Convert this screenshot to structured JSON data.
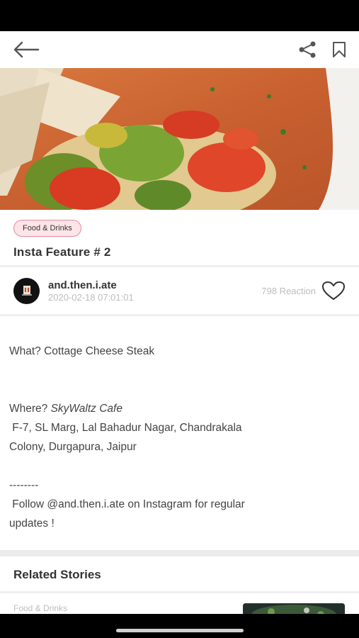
{
  "header": {
    "back_icon": "arrow-left-icon",
    "share_icon": "share-icon",
    "bookmark_icon": "bookmark-icon"
  },
  "post": {
    "category": "Food & Drinks",
    "title": "Insta Feature # 2",
    "author": {
      "name": "and.then.i.ate",
      "date": "2020-02-18 07:01:01"
    },
    "reactions": "798 Reaction",
    "body": {
      "what": "What? Cottage Cheese Steak",
      "where_prefix": "Where?",
      "where_place": "SkyWaltz Cafe",
      "address_1": " F-7, SL Marg, Lal Bahadur Nagar, Chandrakala",
      "address_2": "Colony, Durgapura, Jaipur",
      "separator": "--------",
      "follow_1": " Follow @and.then.i.ate on Instagram for regular",
      "follow_2": "updates !"
    }
  },
  "related": {
    "title": "Related Stories",
    "items": [
      {
        "category": "Food & Drinks"
      }
    ]
  },
  "colors": {
    "tag_bg": "#fde4e8",
    "tag_border": "#e48c9c",
    "muted_text": "#bdbdbd"
  }
}
